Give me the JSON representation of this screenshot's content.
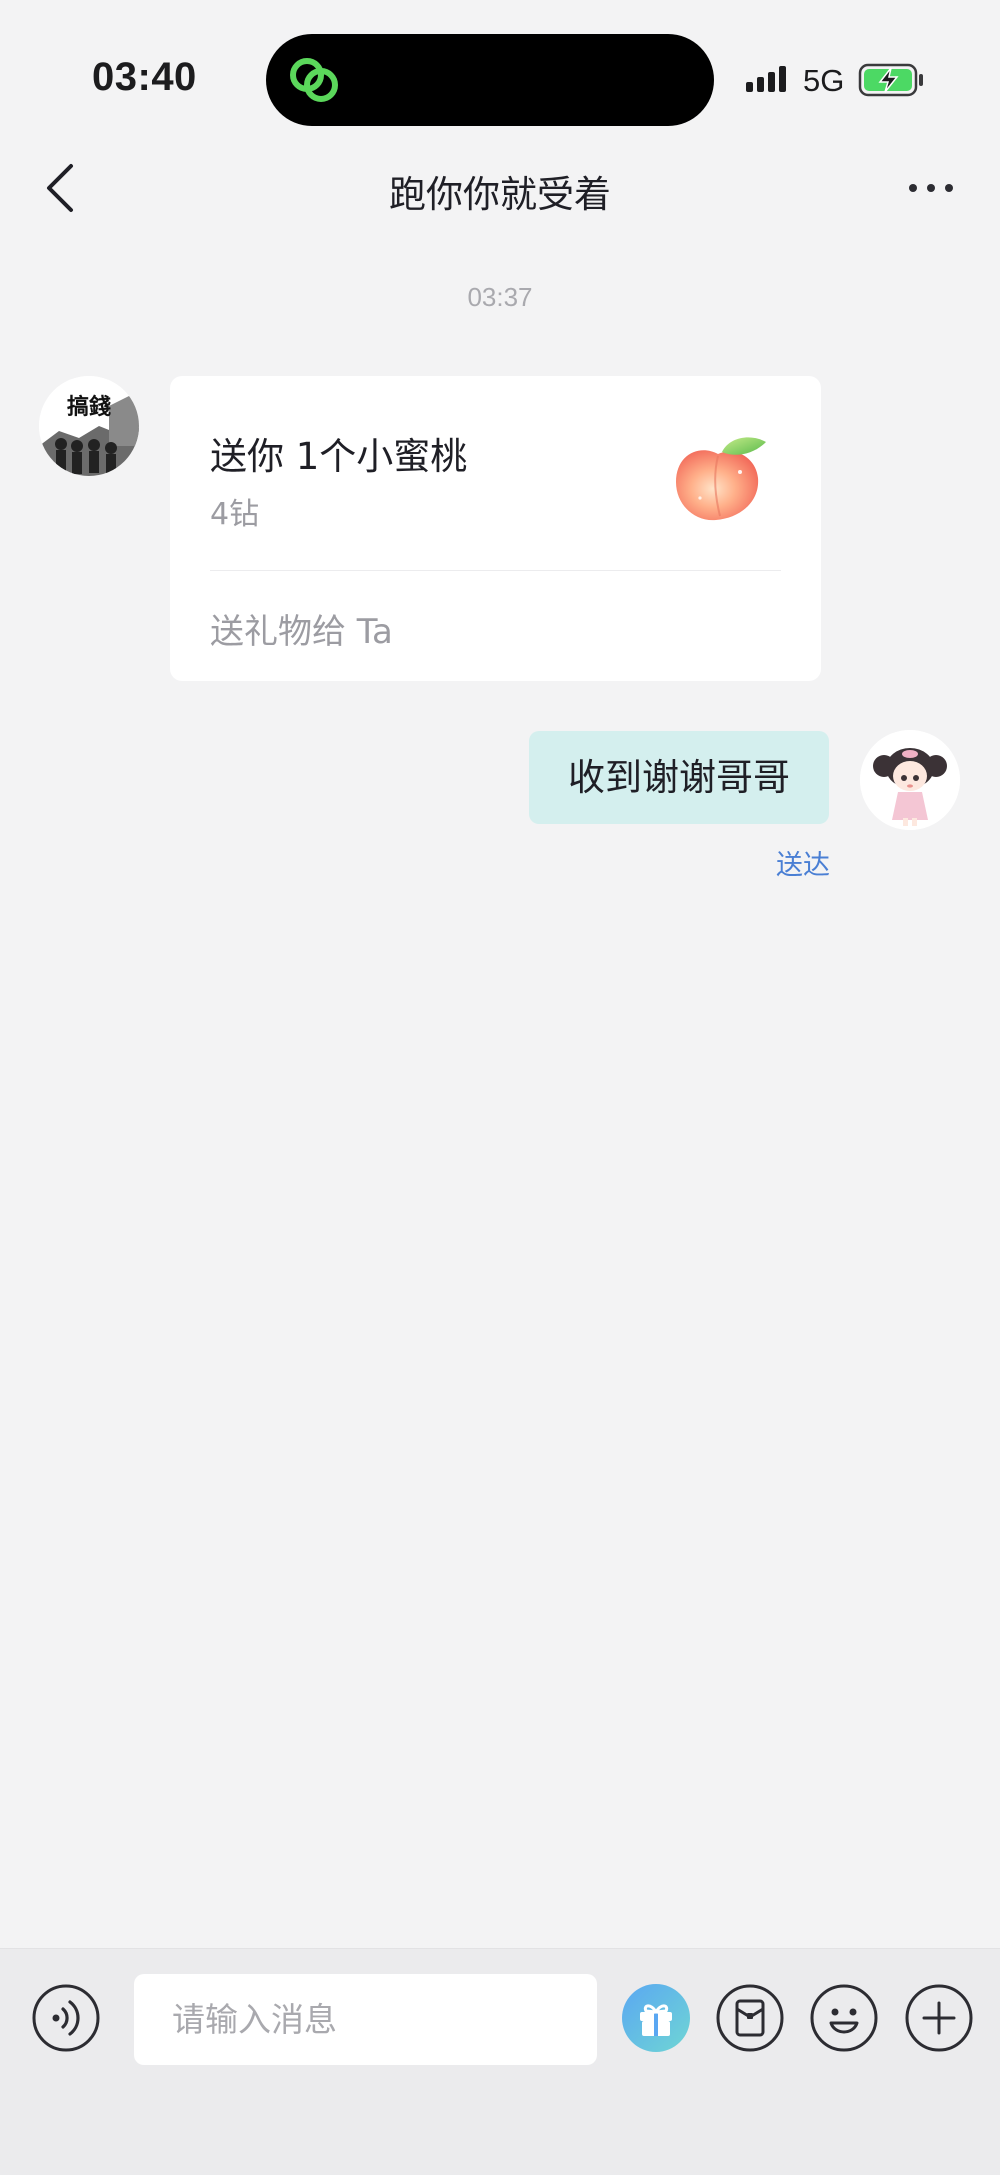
{
  "status_bar": {
    "time": "03:40",
    "network": "5G",
    "signal_icon": "signal-bars-icon",
    "battery_icon": "battery-charging-icon",
    "battery_color": "#4cd964"
  },
  "header": {
    "back_icon": "chevron-left-icon",
    "title": "跑你你就受着",
    "more_icon": "more-dots-icon"
  },
  "conversation": {
    "timestamp": "03:37",
    "messages": [
      {
        "sender": "other",
        "type": "gift",
        "title": "送你 1个小蜜桃",
        "price": "4钻",
        "gift_icon": "peach-icon",
        "action": "送礼物给 Ta"
      },
      {
        "sender": "me",
        "type": "text",
        "text": "收到谢谢哥哥",
        "status": "送达"
      }
    ]
  },
  "input_bar": {
    "placeholder": "请输入消息",
    "voice_icon": "voice-icon",
    "gift_icon": "gift-icon",
    "redpacket_icon": "red-packet-icon",
    "emoji_icon": "emoji-icon",
    "plus_icon": "plus-icon"
  },
  "colors": {
    "background": "#f3f3f4",
    "my_bubble": "#d4efee",
    "delivered_status": "#4a7fd4",
    "gift_button_gradient_start": "#5aa7f2",
    "gift_button_gradient_end": "#6fd6d4",
    "app_logo": "#5bd75b"
  },
  "avatars": {
    "other_avatar_text": "搞錢"
  }
}
